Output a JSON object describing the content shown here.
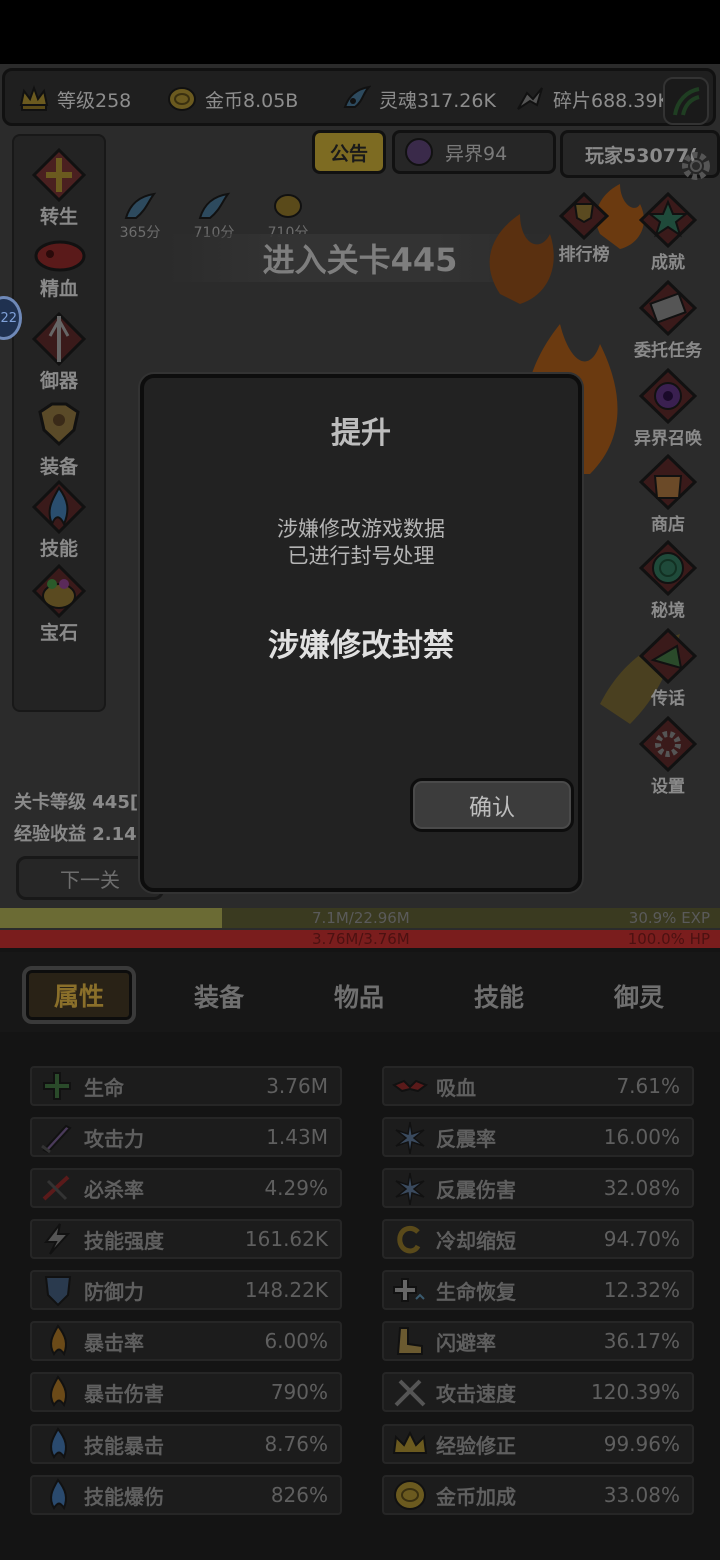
{
  "resources": {
    "level": "等级258",
    "gold": "金币8.05B",
    "soul": "灵魂317.26K",
    "shard": "碎片688.39K"
  },
  "top_tabs": {
    "notice": "公告",
    "other_world": "异界94",
    "player": "玩家53077("
  },
  "left_menu": [
    "转生",
    "精血",
    "御器",
    "装备",
    "技能",
    "宝石"
  ],
  "right_menu": [
    "排行榜",
    "成就",
    "委托任务",
    "异界召唤",
    "商店",
    "秘境",
    "传话",
    "设置"
  ],
  "buffs": [
    "365分",
    "710分",
    "710分"
  ],
  "stage_banner": "进入关卡445",
  "side_bubble": "22",
  "stage_info": {
    "level_line": "关卡等级 445[",
    "exp_line": "经验收益 2.14",
    "next_button": "下一关"
  },
  "exp_bar": {
    "text": "7.1M/22.96M",
    "percent_text": "30.9% EXP",
    "fraction": 0.309
  },
  "hp_bar": {
    "text": "3.76M/3.76M",
    "percent_text": "100.0%  HP",
    "fraction": 1.0
  },
  "bottom_tabs": [
    "属性",
    "装备",
    "物品",
    "技能",
    "御灵"
  ],
  "stats_left": [
    {
      "name": "生命",
      "value": "3.76M",
      "icon": "cross-heal-icon"
    },
    {
      "name": "攻击力",
      "value": "1.43M",
      "icon": "sword-icon"
    },
    {
      "name": "必杀率",
      "value": "4.29%",
      "icon": "crit-slash-icon"
    },
    {
      "name": "技能强度",
      "value": "161.62K",
      "icon": "lightning-icon"
    },
    {
      "name": "防御力",
      "value": "148.22K",
      "icon": "shield-icon"
    },
    {
      "name": "暴击率",
      "value": "6.00%",
      "icon": "flame-icon"
    },
    {
      "name": "暴击伤害",
      "value": "790%",
      "icon": "flame-icon"
    },
    {
      "name": "技能暴击",
      "value": "8.76%",
      "icon": "blue-flame-icon"
    },
    {
      "name": "技能爆伤",
      "value": "826%",
      "icon": "blue-flame-icon"
    }
  ],
  "stats_right": [
    {
      "name": "吸血",
      "value": "7.61%",
      "icon": "bat-icon"
    },
    {
      "name": "反震率",
      "value": "16.00%",
      "icon": "spark-icon"
    },
    {
      "name": "反震伤害",
      "value": "32.08%",
      "icon": "spark-icon"
    },
    {
      "name": "冷却缩短",
      "value": "94.70%",
      "icon": "cooldown-icon"
    },
    {
      "name": "生命恢复",
      "value": "12.32%",
      "icon": "regen-icon"
    },
    {
      "name": "闪避率",
      "value": "36.17%",
      "icon": "boot-icon"
    },
    {
      "name": "攻击速度",
      "value": "120.39%",
      "icon": "swords-icon"
    },
    {
      "name": "经验修正",
      "value": "99.96%",
      "icon": "crown-icon"
    },
    {
      "name": "金币加成",
      "value": "33.08%",
      "icon": "coin-icon"
    }
  ],
  "dialog": {
    "title": "提升",
    "message_line1": "涉嫌修改游戏数据",
    "message_line2": "已进行封号处理",
    "ban_text": "涉嫌修改封禁",
    "confirm_label": "确认"
  },
  "colors": {
    "accent_gold": "#8a6f2a",
    "hp_red": "#7a1d1d",
    "exp_olive": "#6b6b34",
    "dialog_bg": "#222222"
  }
}
